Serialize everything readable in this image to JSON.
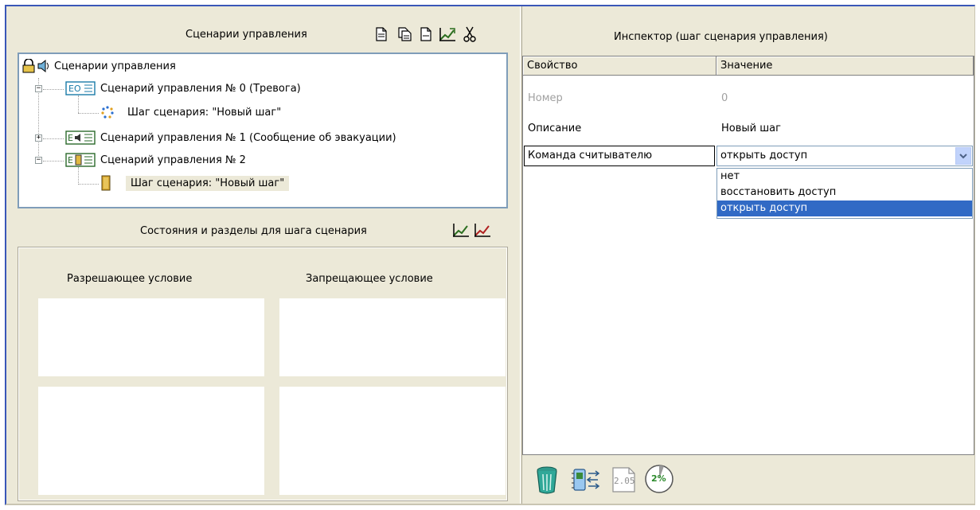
{
  "left_panel": {
    "title": "Сценарии управления",
    "toolbar_icons": [
      "new-document-icon",
      "copy-document-icon",
      "blank-document-icon",
      "edit-chart-icon",
      "cut-icon"
    ]
  },
  "tree": {
    "root_label": "Сценарии управления",
    "nodes": [
      {
        "label": "Сценарий управления № 0 (Тревога)",
        "expanded": true
      },
      {
        "label": "Шаг сценария: \"Новый шаг\""
      },
      {
        "label": "Сценарий управления № 1 (Сообщение об эвакуации)",
        "expanded": false
      },
      {
        "label": "Сценарий управления № 2",
        "expanded": true
      },
      {
        "label": "Шаг сценария: \"Новый шаг\"",
        "selected": true
      }
    ],
    "expander_open": "−",
    "expander_closed": "+"
  },
  "conditions": {
    "title": "Состояния и разделы для шага сценария",
    "allow_label": "Разрешающее условие",
    "deny_label": "Запрещающее условие"
  },
  "inspector": {
    "title": "Инспектор (шаг сценария управления)",
    "col_property": "Свойство",
    "col_value": "Значение",
    "rows": [
      {
        "property": "Номер",
        "value": "0",
        "disabled": true
      },
      {
        "property": "Описание",
        "value": "Новый шаг"
      },
      {
        "property": "Команда считывателю",
        "value": "открыть доступ"
      }
    ],
    "dropdown_options": [
      "нет",
      "восстановить доступ",
      "открыть доступ"
    ],
    "dropdown_selected": "открыть доступ"
  },
  "bottom_toolbar": {
    "version_label": "2.05",
    "percent_label": "2%"
  },
  "colors": {
    "window_bg": "#ece9d8",
    "accent_border": "#3a57b8",
    "selection": "#316ac5",
    "tree_border": "#7f9db9"
  }
}
